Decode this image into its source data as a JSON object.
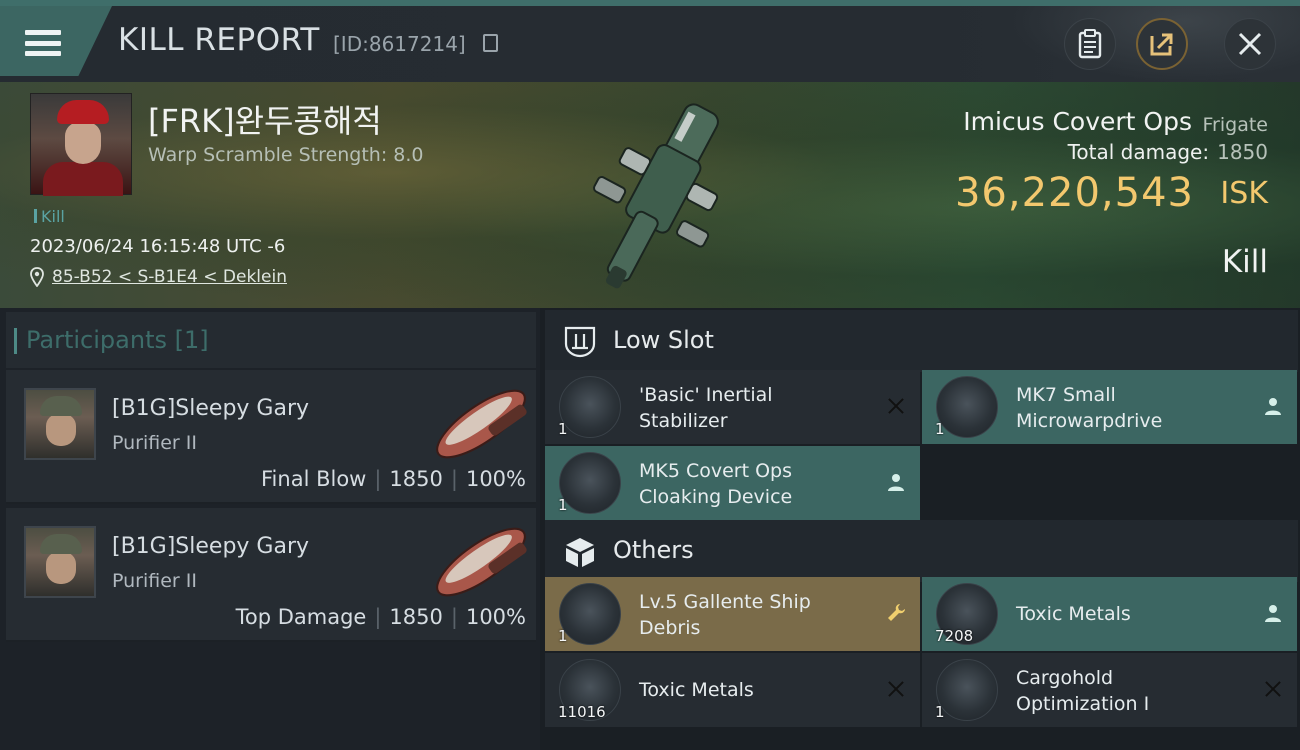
{
  "header": {
    "title": "KILL REPORT",
    "report_id": "[ID:8617214]"
  },
  "victim": {
    "name": "[FRK]완두콩해적",
    "warp_scramble": "Warp Scramble Strength: 8.0",
    "tag": "Kill",
    "datetime": "2023/06/24 16:15:48 UTC -6",
    "location": "85-B52 < S-B1E4 < Deklein"
  },
  "ship": {
    "name": "Imicus Covert Ops",
    "class": "Frigate",
    "total_damage_label": "Total damage:",
    "total_damage": "1850",
    "isk_value": "36,220,543",
    "isk_unit": "ISK",
    "result": "Kill"
  },
  "participants": {
    "title": "Participants [1]",
    "rows": [
      {
        "name": "[B1G]Sleepy Gary",
        "ship": "Purifier II",
        "role": "Final Blow",
        "damage": "1850",
        "percent": "100%"
      },
      {
        "name": "[B1G]Sleepy Gary",
        "ship": "Purifier II",
        "role": "Top Damage",
        "damage": "1850",
        "percent": "100%"
      }
    ]
  },
  "sections": {
    "low_slot": "Low Slot",
    "others": "Others"
  },
  "items": [
    {
      "name_line1": "'Basic' Inertial",
      "name_line2": "Stabilizer",
      "qty": "1"
    },
    {
      "name_line1": "MK7 Small",
      "name_line2": "Microwarpdrive",
      "qty": "1"
    },
    {
      "name_line1": "MK5 Covert Ops",
      "name_line2": "Cloaking Device",
      "qty": "1"
    },
    {
      "name_line1": "Lv.5 Gallente Ship",
      "name_line2": "Debris",
      "qty": "1"
    },
    {
      "name": "Toxic Metals",
      "qty": "7208"
    },
    {
      "name": "Toxic Metals",
      "qty": "11016"
    },
    {
      "name_line1": "Cargohold",
      "name_line2": "Optimization I",
      "qty": "1"
    }
  ],
  "colors": {
    "accent_teal": "#3c6662",
    "isk_gold": "#f3c86e",
    "item_gold": "#7a6b49"
  },
  "icons": [
    "menu-icon",
    "copy-icon",
    "clipboard-icon",
    "share-icon",
    "close-icon",
    "location-pin-icon",
    "low-slot-icon",
    "others-cube-icon",
    "x-mark-icon",
    "person-icon",
    "wrench-icon"
  ]
}
